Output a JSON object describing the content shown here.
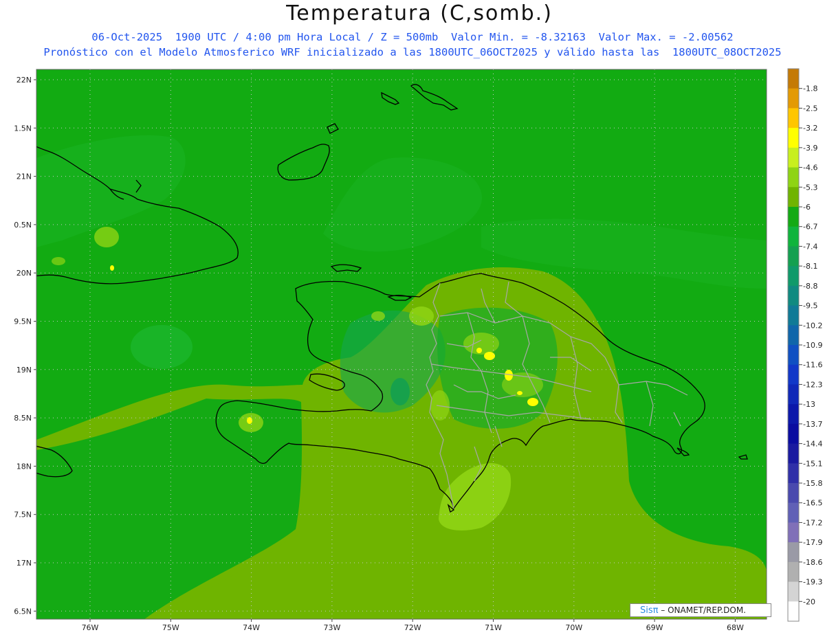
{
  "header": {
    "title": "Temperatura (C,somb.)",
    "line1": "06-Oct-2025  1900 UTC / 4:00 pm Hora Local / Z = 500mb  Valor Min. = -8.32163  Valor Max. = -2.00562",
    "line2": "Pronóstico con el Modelo Atmosferico WRF inicializado a las 1800UTC_06OCT2025 y válido hasta las  1800UTC_08OCT2025"
  },
  "map": {
    "lat_labels": [
      "22N",
      "1.5N",
      "21N",
      "0.5N",
      "20N",
      "9.5N",
      "19N",
      "8.5N",
      "18N",
      "7.5N",
      "17N",
      "6.5N"
    ],
    "lon_labels": [
      "76W",
      "75W",
      "74W",
      "73W",
      "72W",
      "71W",
      "70W",
      "69W",
      "68W"
    ],
    "grid": "dotted",
    "base_fill": "#12ab12"
  },
  "colorbar": {
    "labels": [
      "-1.8",
      "-2.5",
      "-3.2",
      "-3.9",
      "-4.6",
      "-5.3",
      "-6",
      "-6.7",
      "-7.4",
      "-8.1",
      "-8.8",
      "-9.5",
      "-10.2",
      "-10.9",
      "-11.6",
      "-12.3",
      "-13",
      "-13.7",
      "-14.4",
      "-15.1",
      "-15.8",
      "-16.5",
      "-17.2",
      "-17.9",
      "-18.6",
      "-19.3",
      "-20"
    ],
    "colors": [
      "#c47a06",
      "#e39a04",
      "#ffc600",
      "#ffff00",
      "#c8ef1e",
      "#8fd414",
      "#70b400",
      "#14aa14",
      "#10b43c",
      "#14a050",
      "#109a6a",
      "#108a80",
      "#107a96",
      "#1066aa",
      "#1050c2",
      "#1238c8",
      "#1028b8",
      "#0c18aa",
      "#0a0ca0",
      "#1a1aa0",
      "#3030a8",
      "#4a4aae",
      "#6060b6",
      "#8070b8",
      "#9a9aa6",
      "#b0b0b0",
      "#d4d4d4",
      "#ffffff"
    ]
  },
  "credit": {
    "logo": "Sisπ",
    "text": " – ONAMET/REP.DOM."
  }
}
